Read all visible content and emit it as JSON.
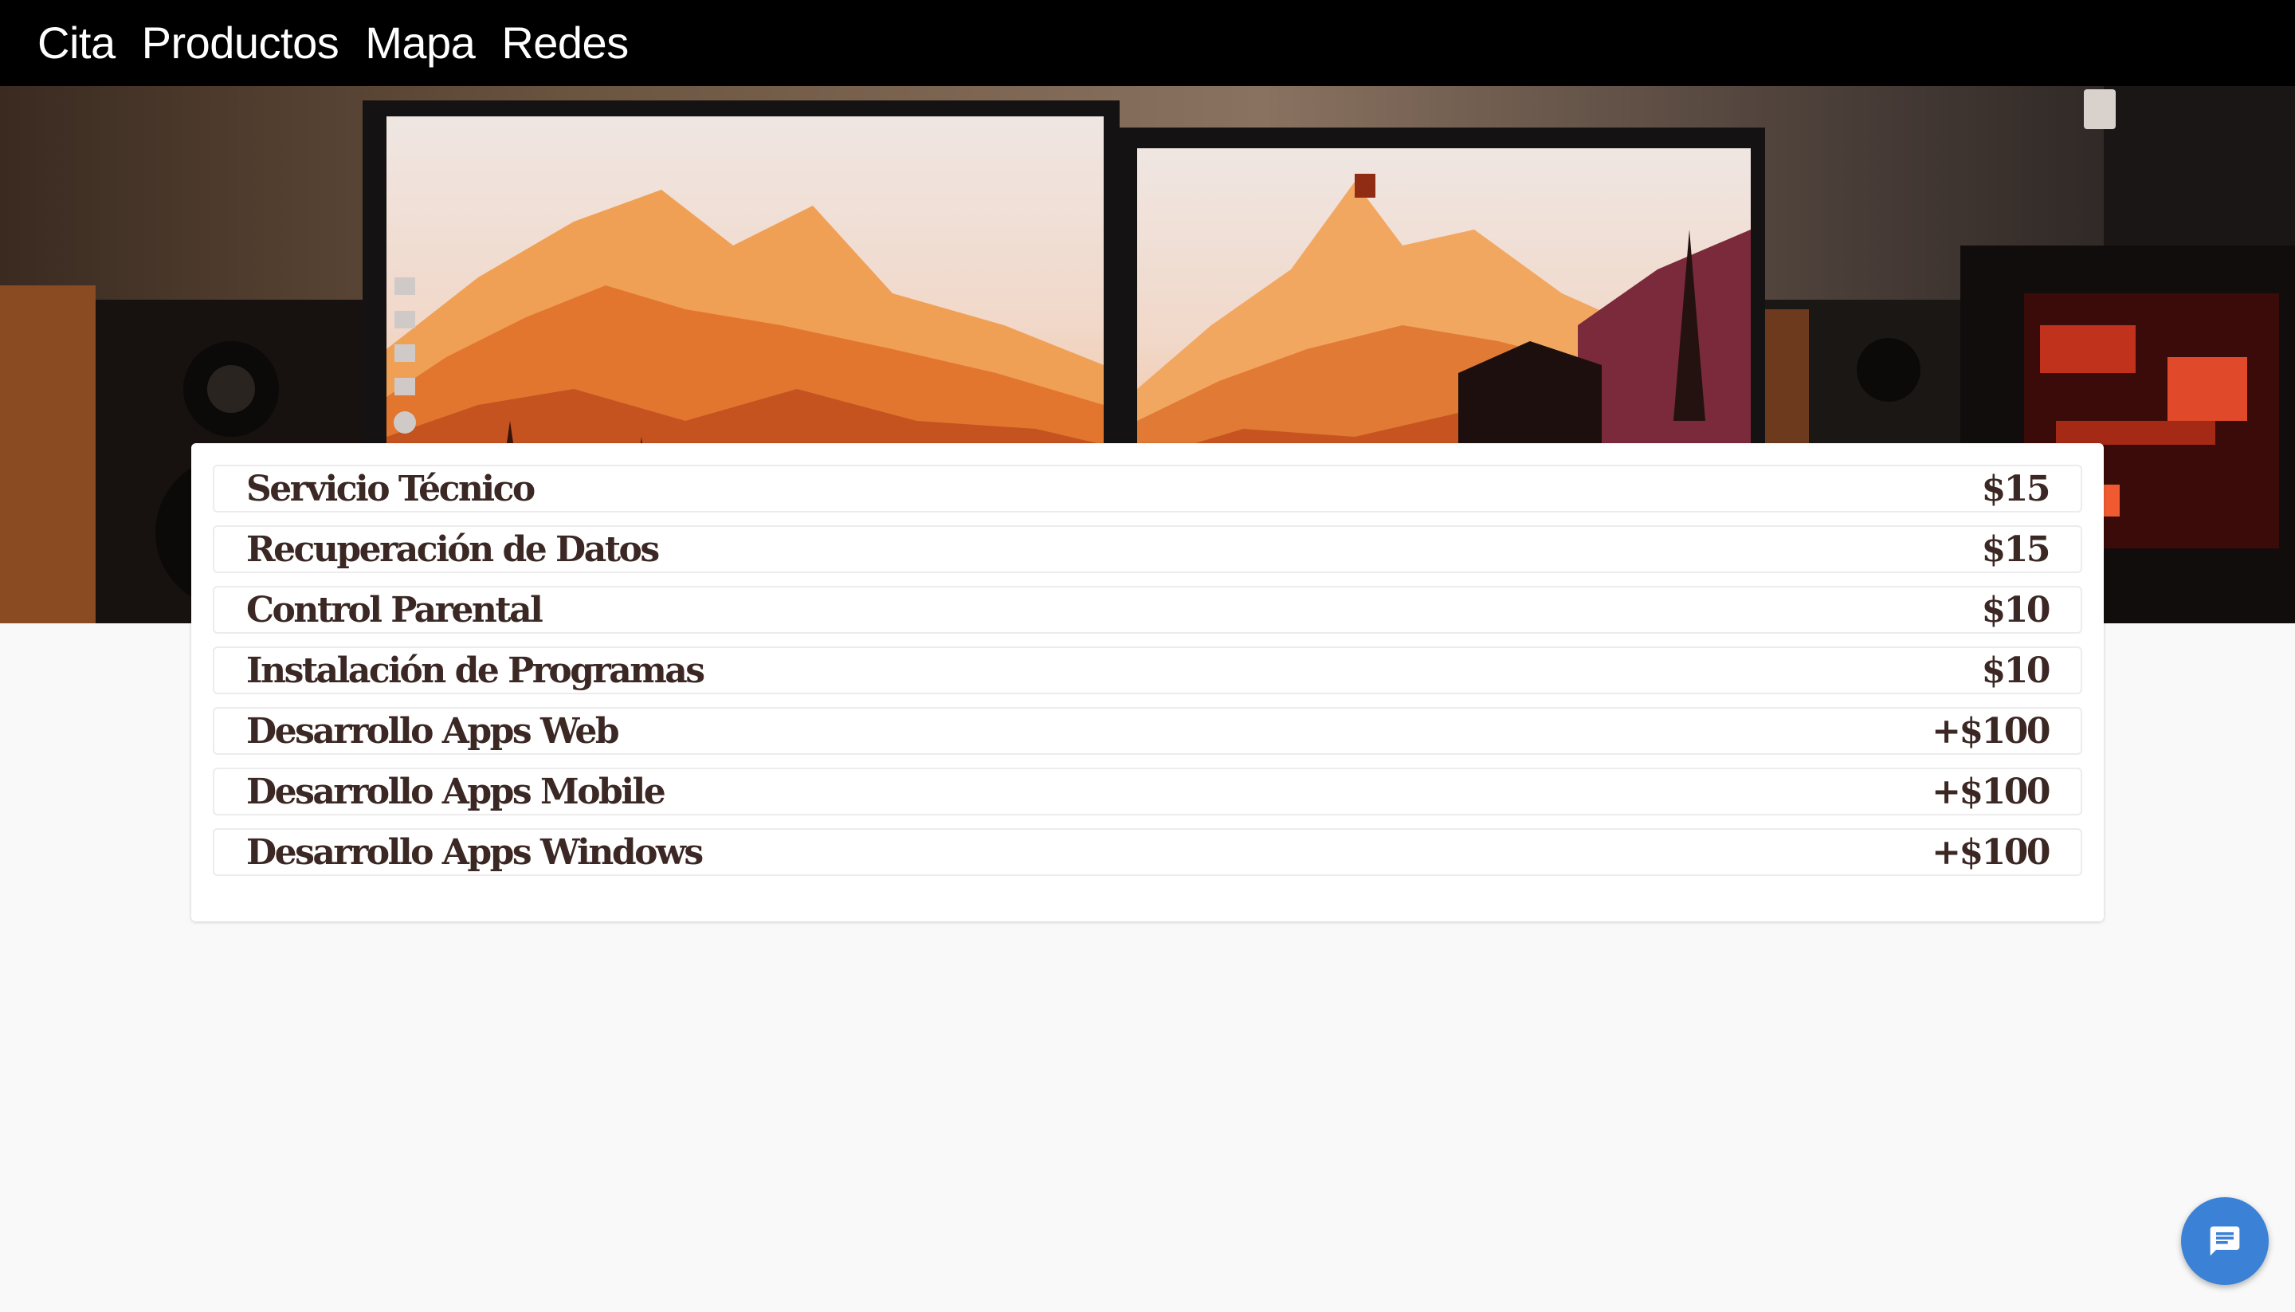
{
  "nav": {
    "items": [
      {
        "label": "Cita"
      },
      {
        "label": "Productos"
      },
      {
        "label": "Mapa"
      },
      {
        "label": "Redes"
      }
    ]
  },
  "hero": {
    "icon": "desk-setup-photo"
  },
  "prices": {
    "items": [
      {
        "name": "Servicio Técnico",
        "price": "$15"
      },
      {
        "name": "Recuperación de Datos",
        "price": "$15"
      },
      {
        "name": "Control Parental",
        "price": "$10"
      },
      {
        "name": "Instalación de Programas",
        "price": "$10"
      },
      {
        "name": "Desarrollo Apps Web",
        "price": "+$100"
      },
      {
        "name": "Desarrollo Apps Mobile",
        "price": "+$100"
      },
      {
        "name": "Desarrollo Apps Windows",
        "price": "+$100"
      }
    ]
  },
  "chat": {
    "icon": "chat-icon",
    "color": "#3b82d6"
  },
  "colors": {
    "nav_bg": "#000000",
    "nav_text": "#ffffff",
    "price_text": "#3b2824",
    "page_bg": "#f9f9f9"
  }
}
